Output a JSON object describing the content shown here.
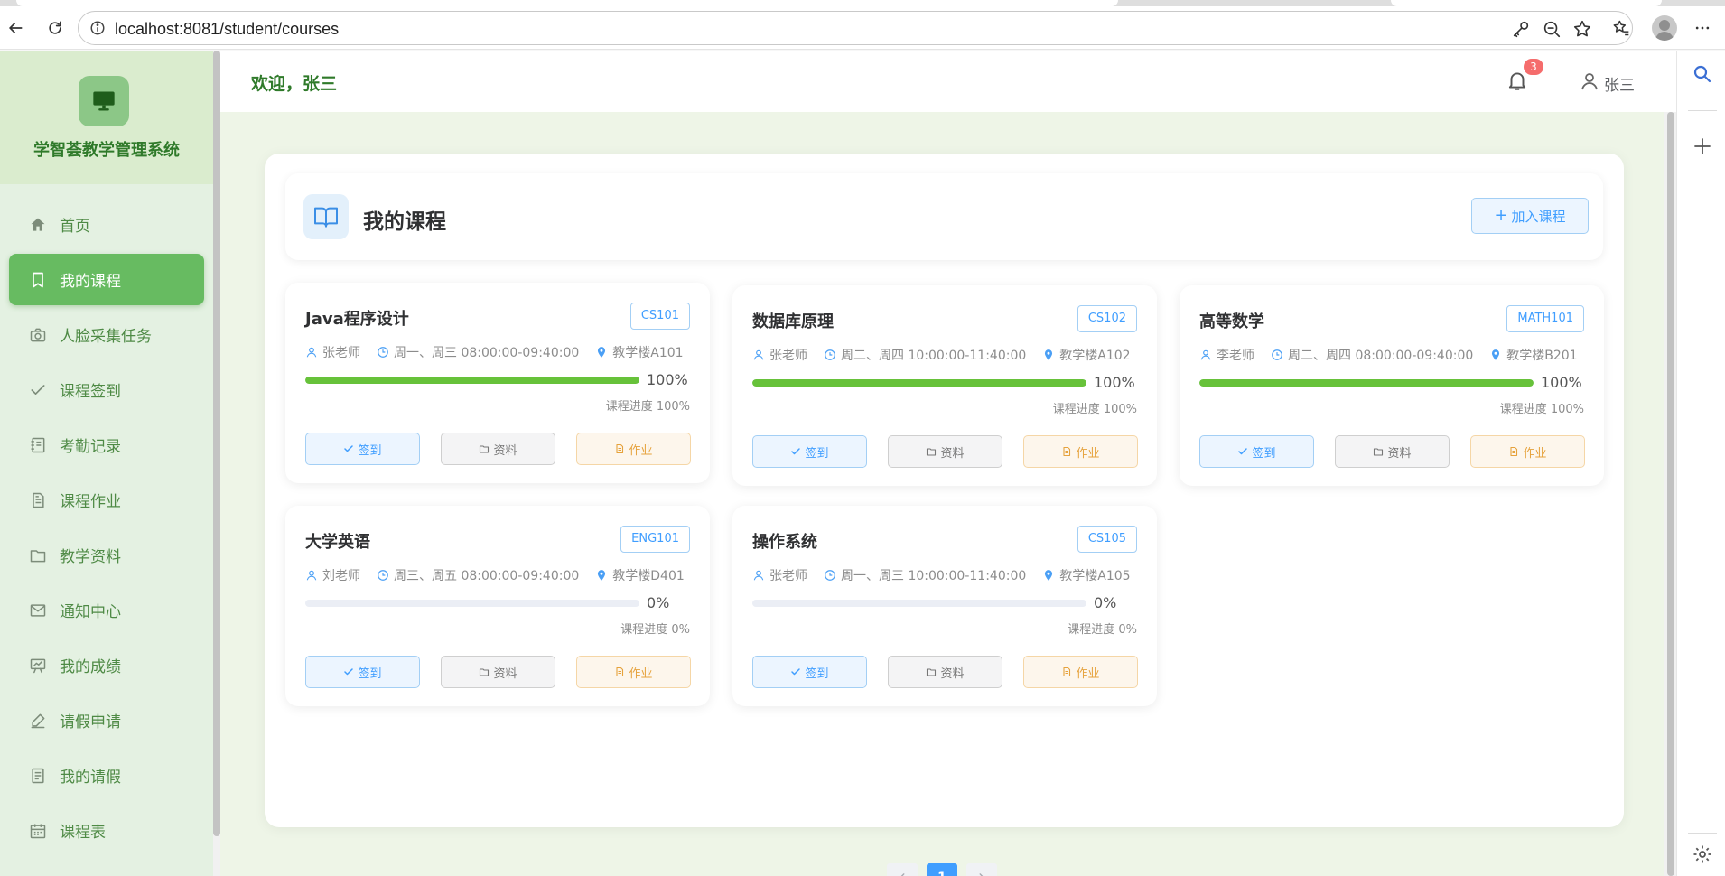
{
  "browser": {
    "url": "localhost:8081/student/courses"
  },
  "sidebar": {
    "brand": "学智荟教学管理系统",
    "items": [
      {
        "label": "首页",
        "icon": "home-icon"
      },
      {
        "label": "我的课程",
        "icon": "bookmark-icon",
        "active": true
      },
      {
        "label": "人脸采集任务",
        "icon": "camera-icon"
      },
      {
        "label": "课程签到",
        "icon": "check-icon"
      },
      {
        "label": "考勤记录",
        "icon": "notebook-icon"
      },
      {
        "label": "课程作业",
        "icon": "document-icon"
      },
      {
        "label": "教学资料",
        "icon": "folder-icon"
      },
      {
        "label": "通知中心",
        "icon": "message-icon"
      },
      {
        "label": "我的成绩",
        "icon": "board-icon"
      },
      {
        "label": "请假申请",
        "icon": "edit-icon"
      },
      {
        "label": "我的请假",
        "icon": "tickets-icon"
      },
      {
        "label": "课程表",
        "icon": "calendar-icon"
      }
    ]
  },
  "header": {
    "welcome": "欢迎，张三",
    "notification_count": "3",
    "user_name": "张三"
  },
  "panel": {
    "title": "我的课程",
    "join_button": "加入课程",
    "progress_prefix": "课程进度 ",
    "buttons": {
      "sign": "签到",
      "resources": "资料",
      "homework": "作业"
    }
  },
  "courses": [
    {
      "name": "Java程序设计",
      "code": "CS101",
      "teacher": "张老师",
      "time": "周一、周三 08:00:00-09:40:00",
      "location": "教学楼A101",
      "progress": 100,
      "progress_text": "100%"
    },
    {
      "name": "数据库原理",
      "code": "CS102",
      "teacher": "张老师",
      "time": "周二、周四 10:00:00-11:40:00",
      "location": "教学楼A102",
      "progress": 100,
      "progress_text": "100%"
    },
    {
      "name": "高等数学",
      "code": "MATH101",
      "teacher": "李老师",
      "time": "周二、周四 08:00:00-09:40:00",
      "location": "教学楼B201",
      "progress": 100,
      "progress_text": "100%"
    },
    {
      "name": "大学英语",
      "code": "ENG101",
      "teacher": "刘老师",
      "time": "周三、周五 08:00:00-09:40:00",
      "location": "教学楼D401",
      "progress": 0,
      "progress_text": "0%"
    },
    {
      "name": "操作系统",
      "code": "CS105",
      "teacher": "张老师",
      "time": "周一、周三 10:00:00-11:40:00",
      "location": "教学楼A105",
      "progress": 0,
      "progress_text": "0%"
    }
  ],
  "pagination": {
    "current": "1"
  },
  "colors": {
    "brand_green": "#2f7a2a",
    "active_nav": "#67bb61",
    "progress_fill": "#67c23a",
    "primary_blue": "#409eff",
    "warning_orange": "#e6a23c",
    "badge_red": "#f56c6c"
  }
}
